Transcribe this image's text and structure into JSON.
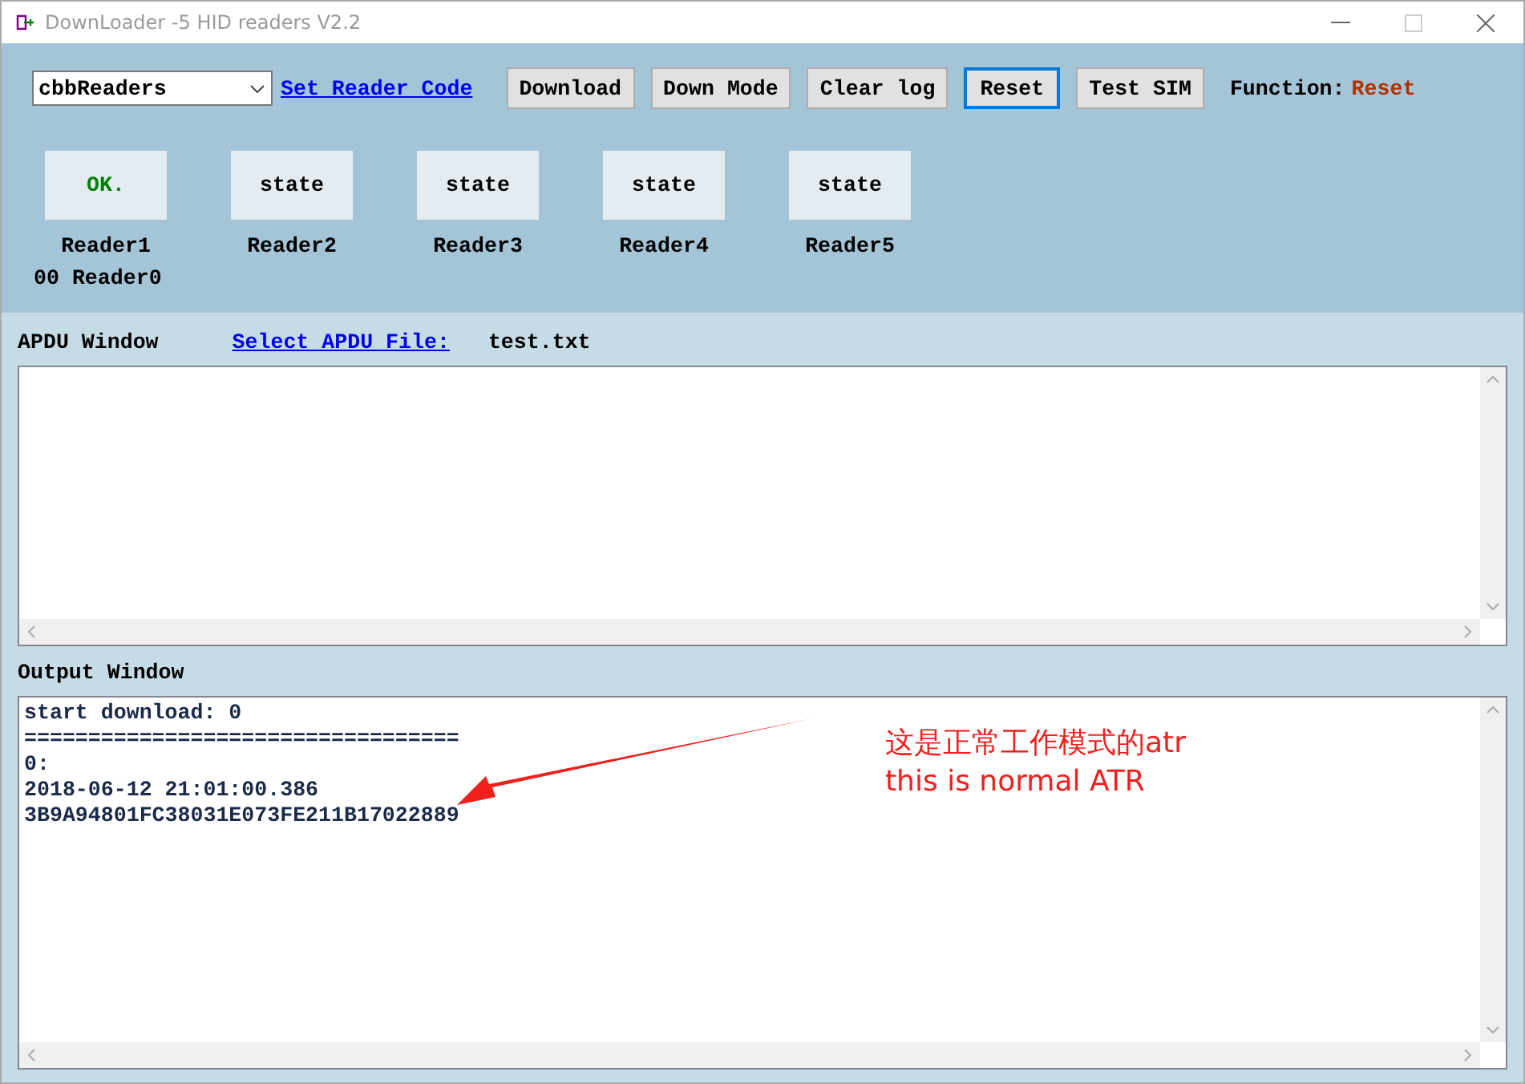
{
  "window": {
    "title": "DownLoader -5 HID readers V2.2"
  },
  "toolbar": {
    "reader_select": {
      "value": "cbbReaders"
    },
    "set_code_link": "Set Reader Code",
    "buttons": [
      {
        "label": "Download",
        "focused": false
      },
      {
        "label": "Down Mode",
        "focused": false
      },
      {
        "label": "Clear log",
        "focused": false
      },
      {
        "label": "Reset",
        "focused": true
      },
      {
        "label": "Test SIM",
        "focused": false
      }
    ],
    "function_label": "Function:",
    "function_value": "Reset"
  },
  "readers": [
    {
      "state": "OK.",
      "name": "Reader1",
      "ok": true
    },
    {
      "state": "state",
      "name": "Reader2",
      "ok": false
    },
    {
      "state": "state",
      "name": "Reader3",
      "ok": false
    },
    {
      "state": "state",
      "name": "Reader4",
      "ok": false
    },
    {
      "state": "state",
      "name": "Reader5",
      "ok": false
    }
  ],
  "reader_info": "00 Reader0",
  "apdu": {
    "label": "APDU Window",
    "link": "Select APDU File:",
    "file": "test.txt"
  },
  "output": {
    "label": "Output Window",
    "lines": [
      "start download: 0",
      "==================================",
      "0:",
      "2018-06-12 21:01:00.386",
      "3B9A94801FC38031E073FE211B17022889"
    ]
  },
  "annotation": {
    "lines": [
      "这是正常工作模式的atr",
      "this is normal ATR"
    ]
  }
}
